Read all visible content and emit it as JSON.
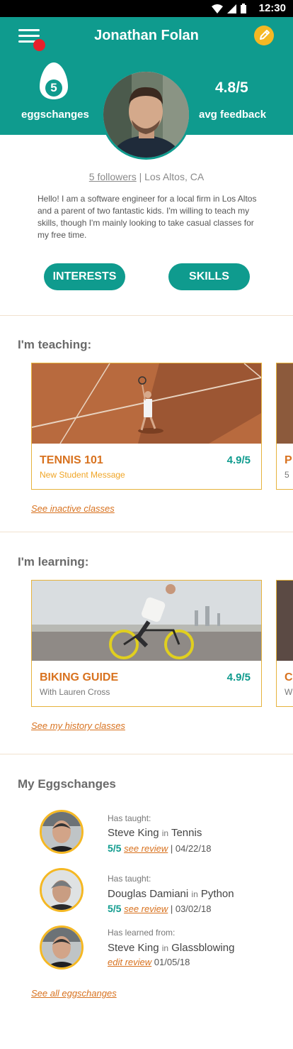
{
  "status_bar": {
    "time": "12:30"
  },
  "header": {
    "title": "Jonathan Folan",
    "eggschanges_count": "5",
    "eggschanges_label": "eggschanges",
    "feedback_value": "4.8/5",
    "feedback_label": "avg feedback"
  },
  "profile": {
    "followers": "5 followers",
    "separator": " | ",
    "location": "Los Altos, CA",
    "bio": "Hello! I am a software engineer for a local firm in Los Altos and a parent of two fantastic kids. I'm willing to teach my skills, though I'm mainly looking to take casual classes for my free time.",
    "interests_label": "INTERESTS",
    "skills_label": "SKILLS"
  },
  "teaching": {
    "title": "I'm teaching:",
    "card": {
      "title": "TENNIS 101",
      "rating": "4.9/5",
      "subtitle": "New Student Message"
    },
    "peek": {
      "title": "P",
      "subtitle": "5"
    },
    "link": "See inactive classes"
  },
  "learning": {
    "title": "I'm learning:",
    "card": {
      "title": "BIKING GUIDE",
      "rating": "4.9/5",
      "subtitle": "With Lauren Cross"
    },
    "peek": {
      "title": "C",
      "subtitle": "W"
    },
    "link": "See my history classes"
  },
  "eggschanges": {
    "title": "My Eggschanges",
    "items": [
      {
        "label": "Has taught:",
        "name": "Steve King",
        "in": "in",
        "subject": "Tennis",
        "score": "5/5",
        "review_link": "see review",
        "date": "| 04/22/18"
      },
      {
        "label": "Has taught:",
        "name": "Douglas Damiani",
        "in": "in",
        "subject": "Python",
        "score": "5/5",
        "review_link": "see review",
        "date": "| 03/02/18"
      },
      {
        "label": "Has learned from:",
        "name": "Steve King",
        "in": "in",
        "subject": "Glassblowing",
        "score": "",
        "review_link": "edit review",
        "date": "01/05/18"
      }
    ],
    "link": "See all eggschanges"
  },
  "colors": {
    "teal": "#0f9b8e",
    "orange": "#d8721f",
    "yellow": "#f5b823",
    "notification_red": "#e8202b"
  }
}
